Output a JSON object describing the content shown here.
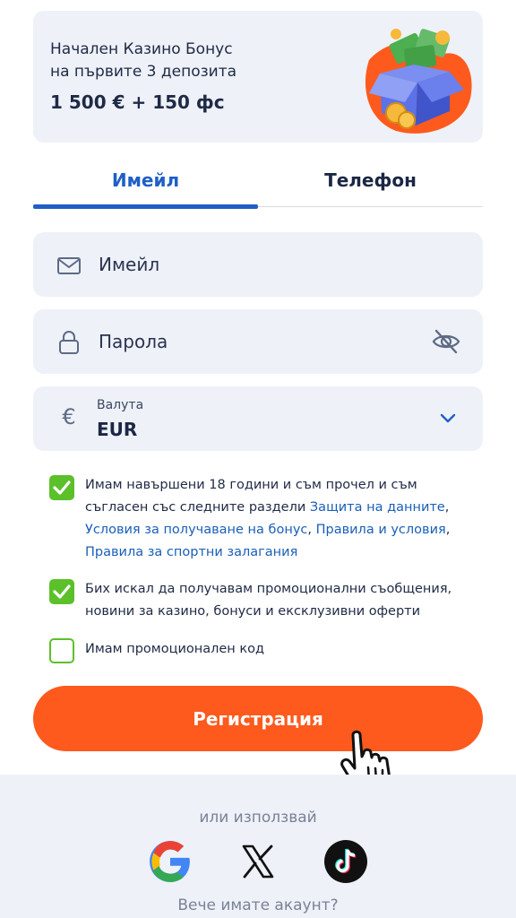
{
  "promo": {
    "line1": "Начален Казино Бонус",
    "line2": "на първите 3 депозита",
    "amount": "1 500 € + 150 фс"
  },
  "tabs": [
    {
      "label": "Имейл",
      "active": true
    },
    {
      "label": "Телефон",
      "active": false
    }
  ],
  "form": {
    "email_placeholder": "Имейл",
    "password_placeholder": "Парола",
    "currency_label": "Валута",
    "currency_symbol": "€",
    "currency_value": "EUR"
  },
  "consents": {
    "terms": {
      "checked": true,
      "text_before": "Имам навършени 18 години и съм прочел и съм съгласен със следните раздели ",
      "link_privacy": "Защита на данните",
      "link_bonus": "Условия за получаване на бонус",
      "link_terms": "Правила и условия",
      "link_sports": "Правила за спортни залагания",
      "sep": ", "
    },
    "marketing": {
      "checked": true,
      "text": "Бих искал да получавам промоционални съобщения, новини за казино, бонуси и ексклузивни оферти"
    },
    "promo_code": {
      "checked": false,
      "text": "Имам промоционален код"
    }
  },
  "register_label": "Регистрация",
  "social": {
    "or_use": "или използвай",
    "providers": [
      "google-icon",
      "x-icon",
      "tiktok-icon"
    ],
    "have_account": "Вече имате акаунт?"
  },
  "colors": {
    "accent_blue": "#1f5fc6",
    "link_blue": "#1a5fb8",
    "checkbox_green": "#5cc02a",
    "cta_orange": "#fe5a1d",
    "panel_bg": "#eef1f8"
  }
}
